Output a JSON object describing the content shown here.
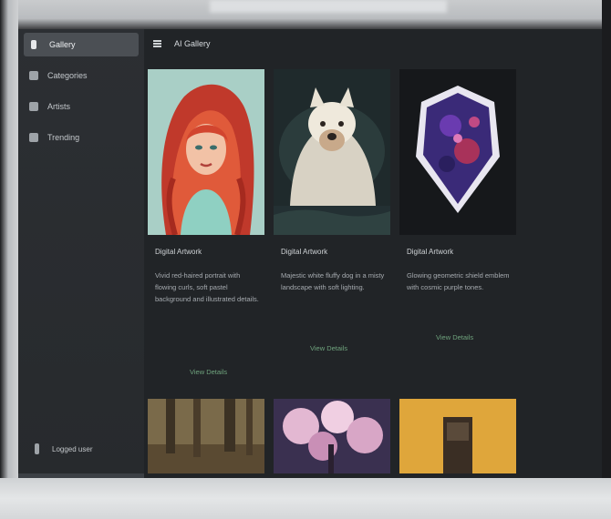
{
  "sidebar": {
    "items": [
      {
        "label": "Gallery",
        "icon": "gallery-icon",
        "active": true
      },
      {
        "label": "Categories",
        "icon": "grid-icon",
        "active": false
      },
      {
        "label": "Artists",
        "icon": "palette-icon",
        "active": false
      },
      {
        "label": "Trending",
        "icon": "chart-icon",
        "active": false
      }
    ],
    "user_label": "Logged user"
  },
  "topbar": {
    "title": "AI Gallery"
  },
  "cards": [
    {
      "title": "Digital Artwork",
      "description": "Vivid red-haired portrait with flowing curls, soft pastel background and illustrated details.",
      "button": "View Details"
    },
    {
      "title": "Digital Artwork",
      "description": "Majestic white fluffy dog in a misty landscape with soft lighting.",
      "button": "View Details"
    },
    {
      "title": "Digital Artwork",
      "description": "Glowing geometric shield emblem with cosmic purple tones.",
      "button": "View Details"
    }
  ],
  "thumbnails": [
    "forest-thumbnail",
    "blossom-thumbnail",
    "doorway-thumbnail"
  ],
  "colors": {
    "accent": "#6fa37d",
    "sidebar": "#2c2f33",
    "main": "#212427"
  }
}
